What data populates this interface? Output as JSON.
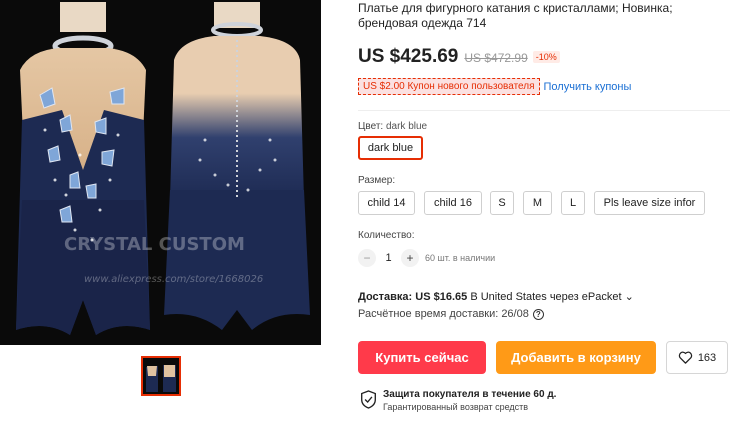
{
  "product": {
    "title": "Платье для фигурного катания с кристаллами; Новинка; брендовая одежда 714",
    "price": "US $425.69",
    "old_price": "US $472.99",
    "discount": "-10%",
    "coupon": "US $2.00 Купон нового пользователя",
    "coupon_link": "Получить купоны",
    "watermark": "CRYSTAL CUSTOM",
    "watermark_url": "www.aliexpress.com/store/1668026"
  },
  "color": {
    "label": "Цвет:",
    "selected": "dark blue",
    "options": [
      "dark blue"
    ]
  },
  "size": {
    "label": "Размер:",
    "options": [
      "child 14",
      "child 16",
      "S",
      "M",
      "L",
      "Pls leave size infor"
    ]
  },
  "quantity": {
    "label": "Количество:",
    "minus": "−",
    "value": "1",
    "plus": "+",
    "stock": "60 шт. в наличии"
  },
  "shipping": {
    "label": "Доставка:",
    "price": "US $16.65",
    "destination": "В United States через ePacket",
    "chevron": "⌄",
    "estimate_label": "Расчётное время доставки:",
    "estimate_date": "26/08",
    "help_glyph": "?"
  },
  "actions": {
    "buy": "Купить сейчас",
    "cart": "Добавить в корзину",
    "wishlist_count": "163"
  },
  "protection": {
    "title": "Защита покупателя в течение 60 д.",
    "subtitle": "Гарантированный возврат средств"
  },
  "colors": {
    "accent": "#e62e04",
    "buy": "#ff3a4a",
    "cart": "#ff9a17",
    "link": "#1a6fd4",
    "dress": "#1d2a52"
  }
}
